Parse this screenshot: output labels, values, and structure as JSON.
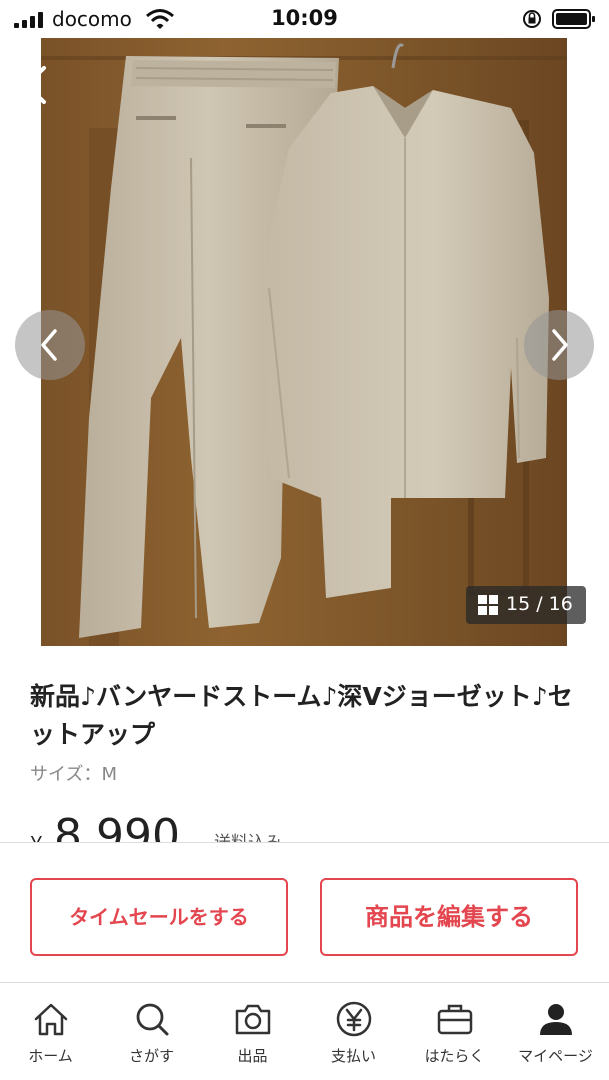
{
  "status_bar": {
    "carrier": "docomo",
    "time": "10:09",
    "icons": [
      "signal-icon",
      "wifi-icon",
      "rotation-lock-icon",
      "battery-icon"
    ]
  },
  "photo": {
    "counter": "15 / 16",
    "icons": [
      "back-icon",
      "chevron-left-icon",
      "chevron-right-icon",
      "grid-icon"
    ]
  },
  "item": {
    "title": "新品♪バンヤードストーム♪深Vジョーゼット♪セットアップ",
    "size": "サイズ：M",
    "price_symbol": "¥",
    "price": "8,990",
    "shipping": "送料込み"
  },
  "actions": {
    "timesale_label": "タイムセールをする",
    "edit_label": "商品を編集する"
  },
  "colors": {
    "accent": "#e4464f",
    "text": "#222222",
    "subtext": "#888888"
  },
  "tabs": [
    {
      "label": "ホーム",
      "icon": "home-icon"
    },
    {
      "label": "さがす",
      "icon": "search-icon"
    },
    {
      "label": "出品",
      "icon": "camera-icon"
    },
    {
      "label": "支払い",
      "icon": "yen-icon"
    },
    {
      "label": "はたらく",
      "icon": "briefcase-icon"
    },
    {
      "label": "マイページ",
      "icon": "user-icon"
    }
  ]
}
